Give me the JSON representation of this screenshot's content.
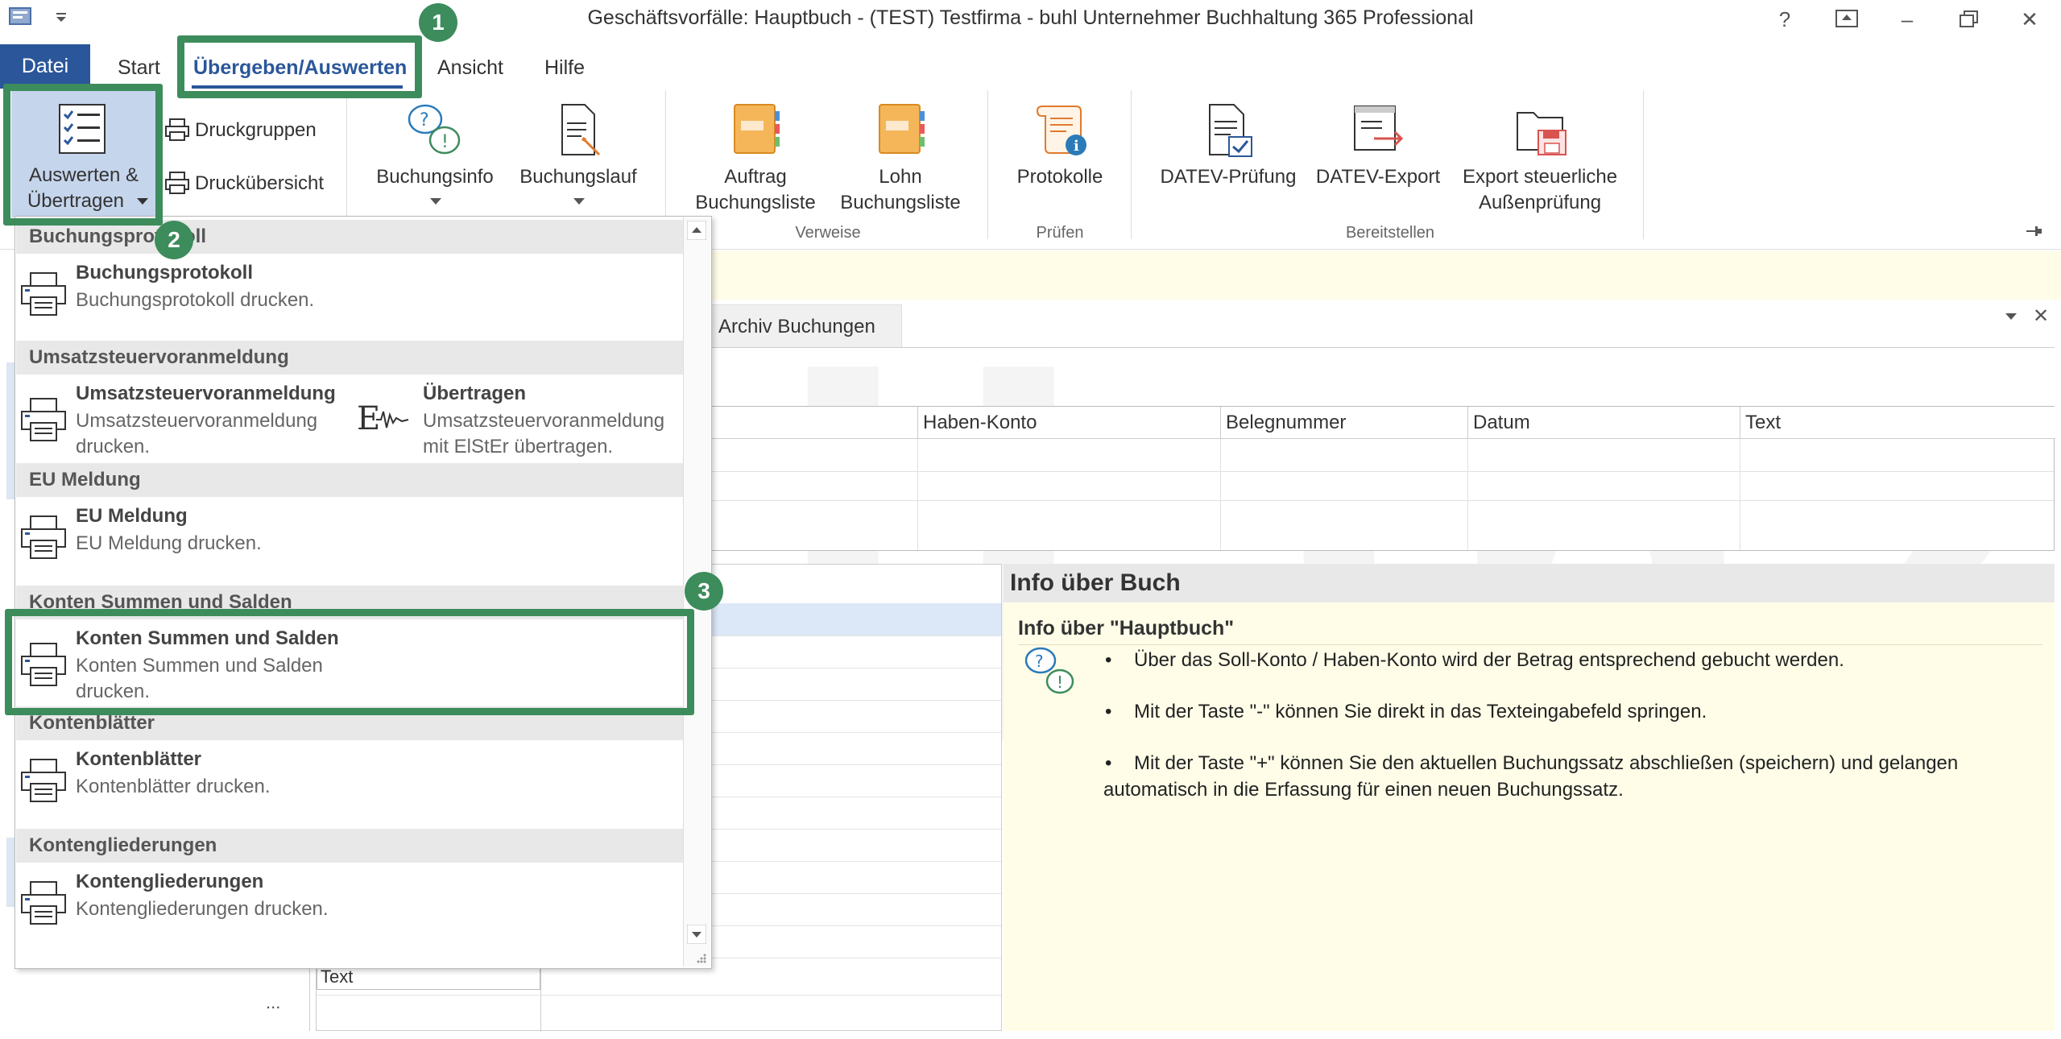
{
  "window": {
    "title": "Geschäftsvorfälle: Hauptbuch - (TEST) Testfirma - buhl Unternehmer Buchhaltung 365 Professional"
  },
  "menu": {
    "tabs": [
      "Datei",
      "Start",
      "Übergeben/Auswerten",
      "Ansicht",
      "Hilfe"
    ]
  },
  "ribbon": {
    "auswerten_label_line1": "Auswerten &",
    "auswerten_label_line2": "Übertragen",
    "druckgruppen": "Druckgruppen",
    "druckuebersicht": "Druckübersicht",
    "buchungsinfo": "Buchungsinfo",
    "buchungslauf": "Buchungslauf",
    "auftrag_line1": "Auftrag",
    "auftrag_line2": "Buchungsliste",
    "lohn_line1": "Lohn",
    "lohn_line2": "Buchungsliste",
    "protokolle": "Protokolle",
    "datev_pruefung": "DATEV-Prüfung",
    "datev_export": "DATEV-Export",
    "export_line1": "Export steuerliche",
    "export_line2": "Außenprüfung",
    "groups": {
      "verweise": "Verweise",
      "pruefen": "Prüfen",
      "bereitstellen": "Bereitstellen"
    }
  },
  "badges": {
    "one": "1",
    "two": "2",
    "three": "3"
  },
  "tabs_doc": {
    "archiv": "Archiv Buchungen"
  },
  "grid": {
    "columns": [
      "Haben-Konto",
      "Belegnummer",
      "Datum",
      "Text"
    ]
  },
  "lower_left": {
    "text_label": "Text",
    "more": "..."
  },
  "info": {
    "header": "Info über Buch",
    "title": "Info über \"Hauptbuch\"",
    "bullets": [
      "Über das Soll-Konto / Haben-Konto wird der Betrag entsprechend gebucht werden.",
      "Mit der Taste \"-\" können Sie direkt in das Texteingabefeld springen.",
      "Mit der Taste \"+\" können Sie den aktuellen Buchungssatz abschließen (speichern) und gelangen",
      "automatisch in die Erfassung für einen neuen Buchungssatz."
    ]
  },
  "dropdown": {
    "sections": [
      {
        "header": "Buchungsprotokoll",
        "title": "Buchungsprotokoll",
        "desc": "Buchungsprotokoll drucken."
      },
      {
        "header": "Umsatzsteuervoranmeldung",
        "title": "Umsatzsteuervoranmeldung",
        "desc1": "Umsatzsteuervoranmeldung",
        "desc2": "drucken.",
        "title2": "Übertragen",
        "desc2a": "Umsatzsteuervoranmeldung",
        "desc2b": "mit ElStEr übertragen."
      },
      {
        "header": "EU Meldung",
        "title": "EU Meldung",
        "desc": "EU Meldung drucken."
      },
      {
        "header": "Konten Summen und Salden",
        "title": "Konten Summen und Salden",
        "desc1": "Konten Summen und Salden",
        "desc2": "drucken."
      },
      {
        "header": "Kontenblätter",
        "title": "Kontenblätter",
        "desc": "Kontenblätter drucken."
      },
      {
        "header": "Kontengliederungen",
        "title": "Kontengliederungen",
        "desc": "Kontengliederungen drucken."
      }
    ]
  },
  "watermark": "eBilanz+"
}
